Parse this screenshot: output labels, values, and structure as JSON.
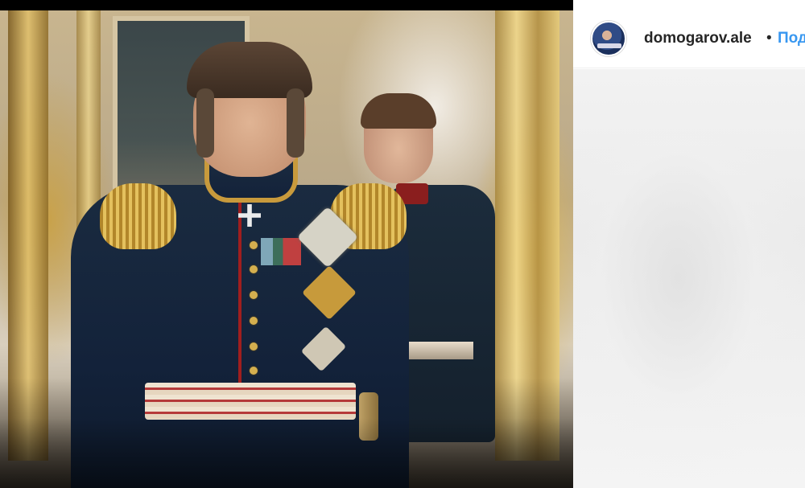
{
  "media": {
    "description_icon": "movie-still-image"
  },
  "post_header": {
    "username": "domogarov.ale",
    "separator": "•",
    "follow_label": "Под"
  },
  "colors": {
    "link_blue": "#3897f0",
    "text_dark": "#262626",
    "divider": "#efefef"
  }
}
